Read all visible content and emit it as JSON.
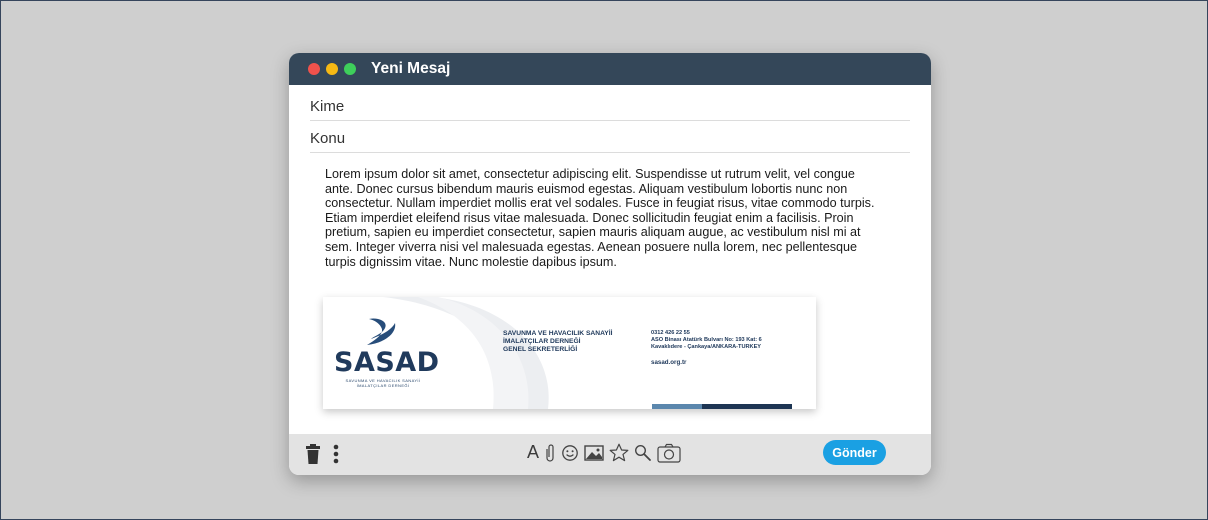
{
  "window": {
    "title": "Yeni Mesaj",
    "controls": [
      "close",
      "minimize",
      "zoom"
    ]
  },
  "compose": {
    "to_placeholder": "Kime",
    "subject_placeholder": "Konu",
    "body": "Lorem ipsum dolor sit amet, consectetur adipiscing elit. Suspendisse ut rutrum velit, vel congue ante. Donec cursus bibendum mauris euismod egestas. Aliquam vestibulum lobortis nunc non consectetur. Nullam imperdiet mollis erat vel sodales. Fusce in feugiat risus, vitae commodo turpis. Etiam imperdiet eleifend risus vitae malesuada. Donec sollicitudin feugiat enim a facilisis. Proin pretium, sapien eu imperdiet consectetur, sapien mauris aliquam augue, ac vestibulum nisl mi at sem. Integer viverra nisi vel malesuada egestas. Aenean posuere nulla lorem, nec pellentesque turpis dignissim vitae. Nunc molestie dapibus ipsum."
  },
  "signature": {
    "logo_text": "SASAD",
    "logo_sub_line1": "SAVUNMA VE HAVACILIK SANAYİİ",
    "logo_sub_line2": "İMALATÇILAR DERNEĞİ",
    "org_line1": "SAVUNMA VE HAVACILIK SANAYİİ",
    "org_line2": "İMALATÇILAR DERNEĞİ",
    "org_line3": "GENEL SEKRETERLİĞİ",
    "phone": "0312 426 22 55",
    "address_line1": "ASO Binası Atatürk Bulvarı No: 193 Kat: 6",
    "address_line2": "Kavaklıdere - Çankaya/ANKARA-TURKEY",
    "website": "sasad.org.tr"
  },
  "toolbar": {
    "left_icons": [
      "trash-icon",
      "more-vertical-icon"
    ],
    "format_icons": [
      "font-icon",
      "attachment-icon",
      "emoji-icon",
      "image-icon",
      "star-icon",
      "search-icon",
      "camera-icon"
    ],
    "font_glyph": "A",
    "send_label": "Gönder"
  },
  "colors": {
    "background": "#cfcfcf",
    "titlebar": "#344759",
    "send_button": "#1aa0e3",
    "toolbar": "#e3e3e3",
    "close": "#f0524c",
    "minimize": "#f6b914",
    "zoom": "#3ecf5b"
  }
}
